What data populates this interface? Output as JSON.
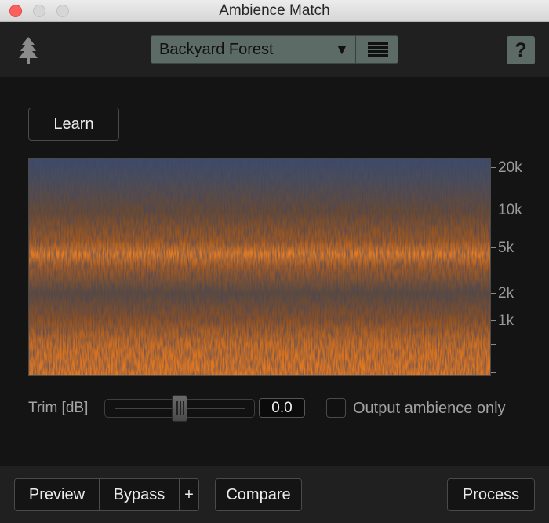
{
  "window": {
    "title": "Ambience Match"
  },
  "header": {
    "logo_icon": "tree-icon",
    "preset": {
      "name": "Backyard Forest",
      "dropdown_icon": "▼",
      "list_icon": "list-icon"
    },
    "help_label": "?"
  },
  "main": {
    "learn_label": "Learn",
    "spectrogram": {
      "frequency_labels": [
        "20k",
        "10k",
        "5k",
        "2k",
        "1k"
      ]
    }
  },
  "trim": {
    "label": "Trim [dB]",
    "value": "0.0",
    "slider_position": 0.5
  },
  "output_ambience": {
    "label": "Output ambience only",
    "checked": false
  },
  "footer": {
    "preview_label": "Preview",
    "bypass_label": "Bypass",
    "plus_label": "+",
    "compare_label": "Compare",
    "process_label": "Process"
  },
  "colors": {
    "accent_orange": "#e8771e",
    "spectrum_blue": "#4a5878",
    "panel_bg": "#141414",
    "preset_bg": "#5d6b66",
    "close_red": "#fc605c"
  }
}
